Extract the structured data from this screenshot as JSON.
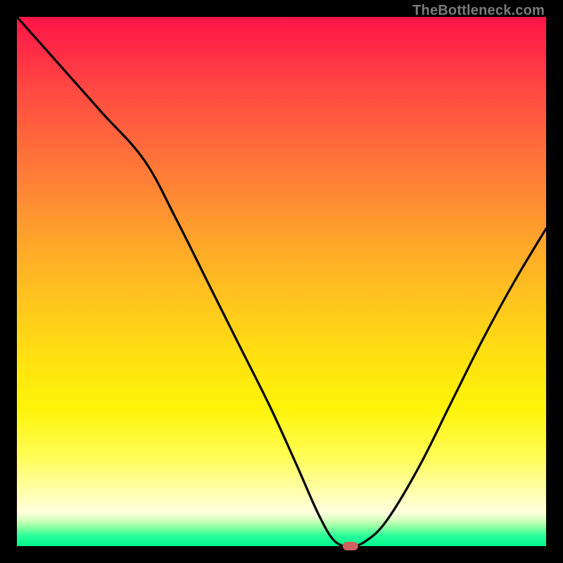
{
  "watermark": "TheBottleneck.com",
  "colors": {
    "frame": "#000000",
    "curve": "#000000",
    "marker": "#d06060",
    "watermark_text": "#7a7a7a"
  },
  "chart_data": {
    "type": "line",
    "title": "",
    "xlabel": "",
    "ylabel": "",
    "xlim": [
      0,
      100
    ],
    "ylim": [
      0,
      100
    ],
    "grid": false,
    "legend": false,
    "series": [
      {
        "name": "bottleneck-curve",
        "x": [
          0,
          8,
          16,
          24,
          30,
          36,
          42,
          48,
          53,
          57,
          60,
          63,
          66,
          70,
          76,
          82,
          88,
          94,
          100
        ],
        "values": [
          100,
          91,
          82,
          73,
          62,
          50,
          38,
          26,
          15,
          6,
          1,
          0,
          1,
          5,
          15,
          27,
          39,
          50,
          60
        ]
      }
    ],
    "marker": {
      "x": 63,
      "y": 0
    },
    "background_gradient": {
      "orientation": "vertical",
      "stops": [
        {
          "pos": 0.0,
          "color": "#ff1547"
        },
        {
          "pos": 0.5,
          "color": "#ffc61e"
        },
        {
          "pos": 0.83,
          "color": "#fffd55"
        },
        {
          "pos": 0.94,
          "color": "#ffffe0"
        },
        {
          "pos": 1.0,
          "color": "#00f58c"
        }
      ]
    }
  }
}
